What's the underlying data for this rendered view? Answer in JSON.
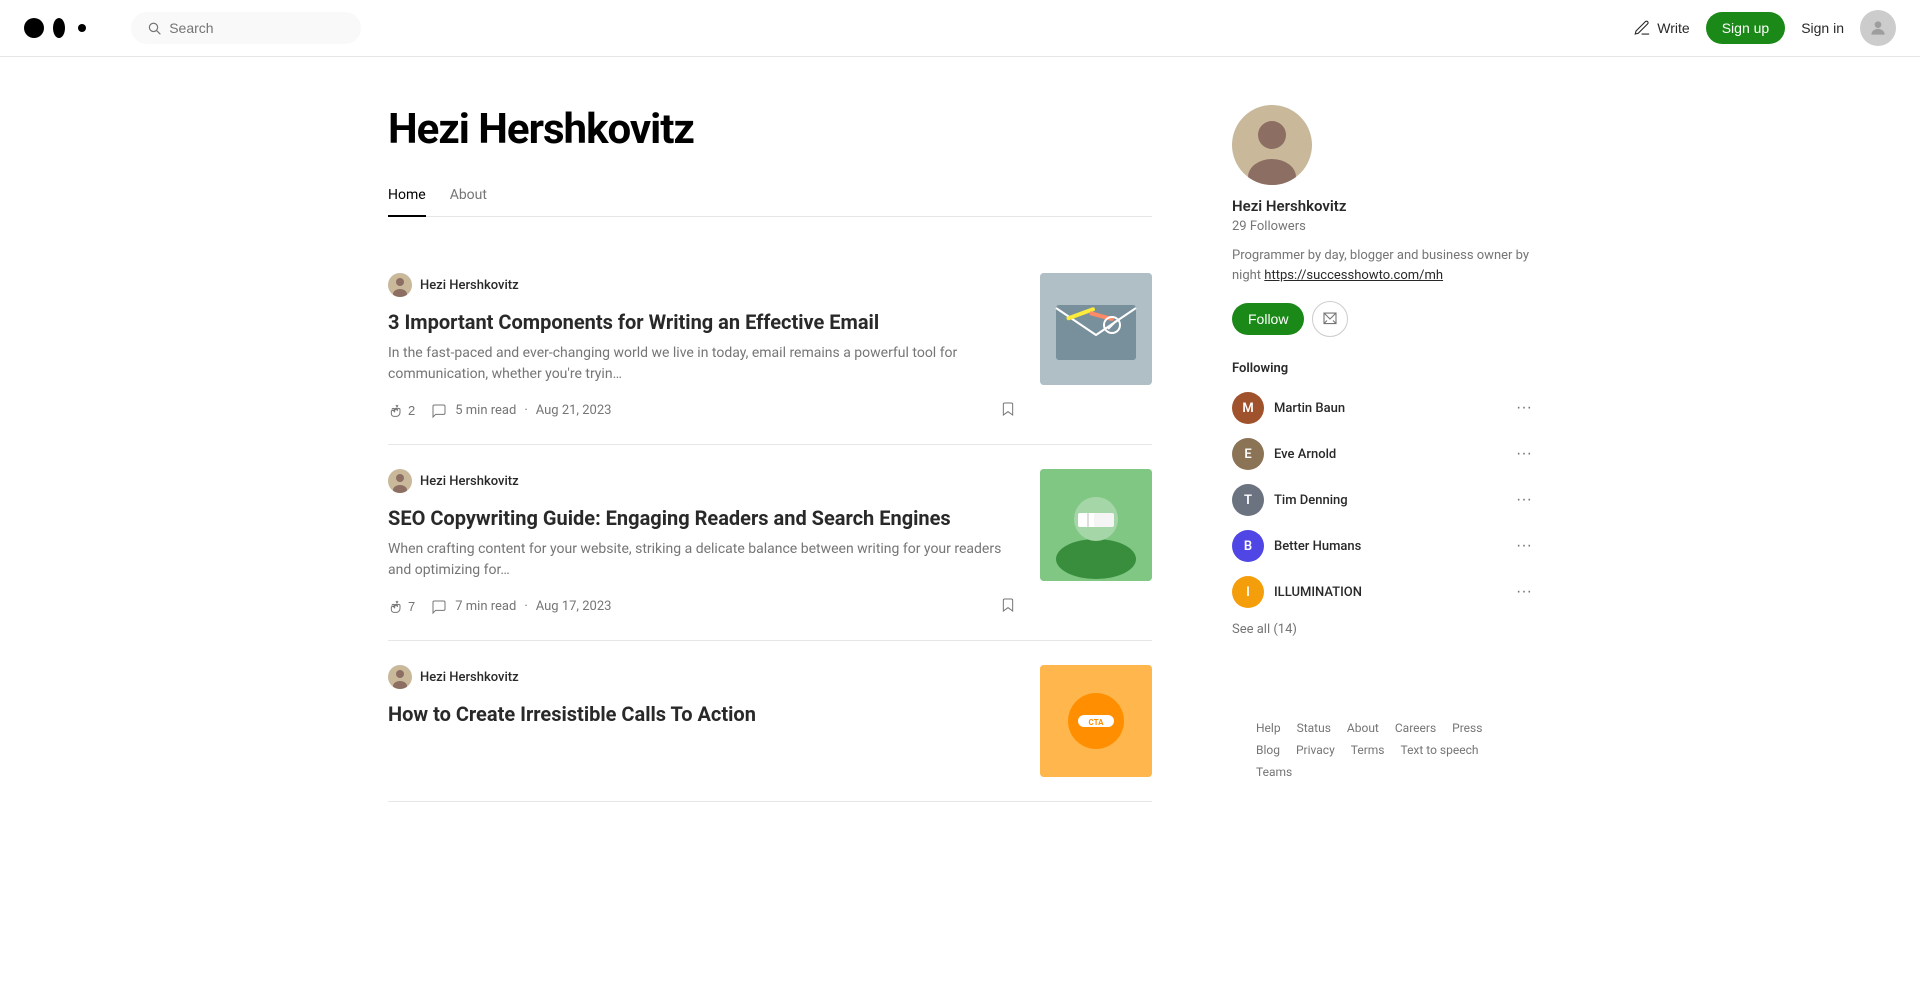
{
  "navbar": {
    "logo_alt": "Medium",
    "search_placeholder": "Search",
    "write_label": "Write",
    "signup_label": "Sign up",
    "signin_label": "Sign in"
  },
  "profile": {
    "name": "Hezi Hershkovitz",
    "tabs": [
      {
        "id": "home",
        "label": "Home",
        "active": true
      },
      {
        "id": "about",
        "label": "About",
        "active": false
      }
    ]
  },
  "sidebar": {
    "name": "Hezi Hershkovitz",
    "followers_count": "29 Followers",
    "bio": "Programmer by day, blogger and business owner by night",
    "bio_link": "https://successhowto.com/mh",
    "follow_label": "Follow",
    "following_section_title": "Following",
    "following_items": [
      {
        "name": "Martin Baun",
        "color": "#a0522d"
      },
      {
        "name": "Eve Arnold",
        "color": "#8b7355"
      },
      {
        "name": "Tim Denning",
        "color": "#6b7280"
      },
      {
        "name": "Better Humans",
        "color": "#4f46e5"
      },
      {
        "name": "ILLUMINATION",
        "color": "#f59e0b"
      }
    ],
    "see_all_label": "See all (14)"
  },
  "articles": [
    {
      "author": "Hezi Hershkovitz",
      "title": "3 Important Components for Writing an Effective Email",
      "excerpt": "In the fast-paced and ever-changing world we live in today, email remains a powerful tool for communication, whether you're tryin…",
      "read_time": "5 min read",
      "date": "Aug 21, 2023",
      "claps": "2",
      "comments": "",
      "thumbnail_color": "#b0bec5",
      "thumbnail_label": "email"
    },
    {
      "author": "Hezi Hershkovitz",
      "title": "SEO Copywriting Guide: Engaging Readers and Search Engines",
      "excerpt": "When crafting content for your website, striking a delicate balance between writing for your readers and optimizing for…",
      "read_time": "7 min read",
      "date": "Aug 17, 2023",
      "claps": "7",
      "comments": "",
      "thumbnail_color": "#81c784",
      "thumbnail_label": "reading"
    },
    {
      "author": "Hezi Hershkovitz",
      "title": "How to Create Irresistible Calls To Action",
      "excerpt": "",
      "read_time": "",
      "date": "",
      "claps": "",
      "comments": "",
      "thumbnail_color": "#ffb74d",
      "thumbnail_label": "cta"
    }
  ],
  "footer": {
    "links": [
      "Help",
      "Status",
      "About",
      "Careers",
      "Press",
      "Blog",
      "Privacy",
      "Terms",
      "Text to speech",
      "Teams"
    ]
  }
}
